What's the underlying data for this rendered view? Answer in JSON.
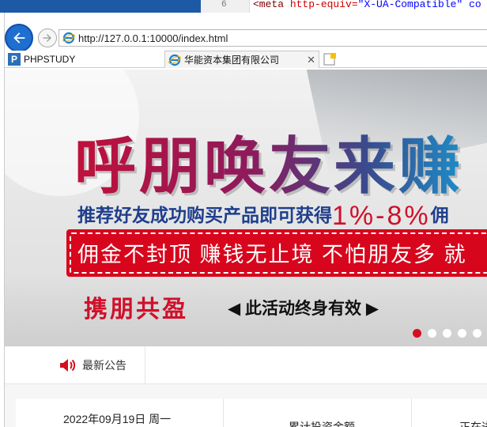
{
  "editor": {
    "line_number": "6",
    "code_prefix": "<meta ",
    "code_attr": "http-equiv=",
    "code_value": "\"X-UA-Compatible\"",
    "code_suffix": " co"
  },
  "browser": {
    "url": "http://127.0.0.1:10000/index.html",
    "tabs": [
      {
        "label": "PHPSTUDY"
      },
      {
        "label": "华能资本集团有限公司"
      }
    ],
    "close_glyph": "✕"
  },
  "banner": {
    "headline": "呼朋唤友来赚",
    "subline_text": "推荐好友成功购买产品即可获得",
    "subline_pct": "1%-8%",
    "subline_tail": "佣",
    "red_bar_text": "佣金不封顶  赚钱无止境  不怕朋友多  就",
    "slogan": "携朋共盈",
    "slogan_note": "◀ 此活动终身有效 ▶",
    "slides": 5,
    "active_slide": 0
  },
  "notice": {
    "label": "最新公告"
  },
  "stats": {
    "date": "2022年09月19日 周一",
    "total_investment_label": "累计投资金额",
    "third_label": "正在进"
  }
}
